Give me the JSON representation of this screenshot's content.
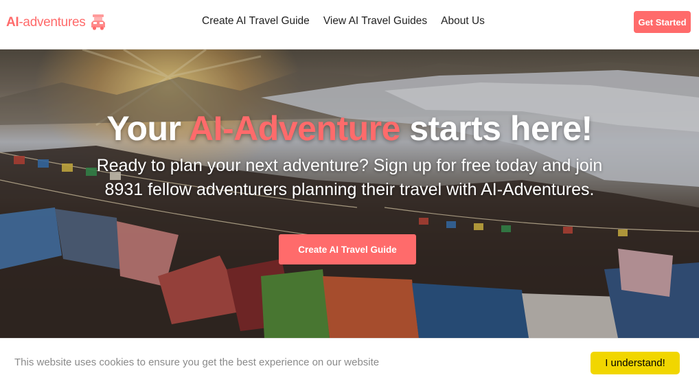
{
  "header": {
    "brand": {
      "prefix": "AI",
      "suffix": "-adventures",
      "logo_icon": "car-with-luggage-icon"
    },
    "nav": [
      "Create AI Travel Guide",
      "View AI Travel Guides",
      "About Us"
    ],
    "cta_label": "Get Started"
  },
  "hero": {
    "title_start": "Your ",
    "title_accent": "AI-Adventure",
    "title_end": " starts here!",
    "subtitle_line1": "Ready to plan your next adventure? Sign up for free today and join",
    "subtitle_line2": "8931 fellow adventurers planning their travel with AI-Adventures.",
    "button_label": "Create AI Travel Guide"
  },
  "cookie": {
    "message": "This website uses cookies to ensure you get the best experience on our website",
    "button_label": "I understand!"
  },
  "colors": {
    "accent": "#ff6b6b",
    "cookie_button": "#f1d600",
    "nav_text": "#1f1f1f",
    "cookie_text": "#8a8a8a"
  }
}
